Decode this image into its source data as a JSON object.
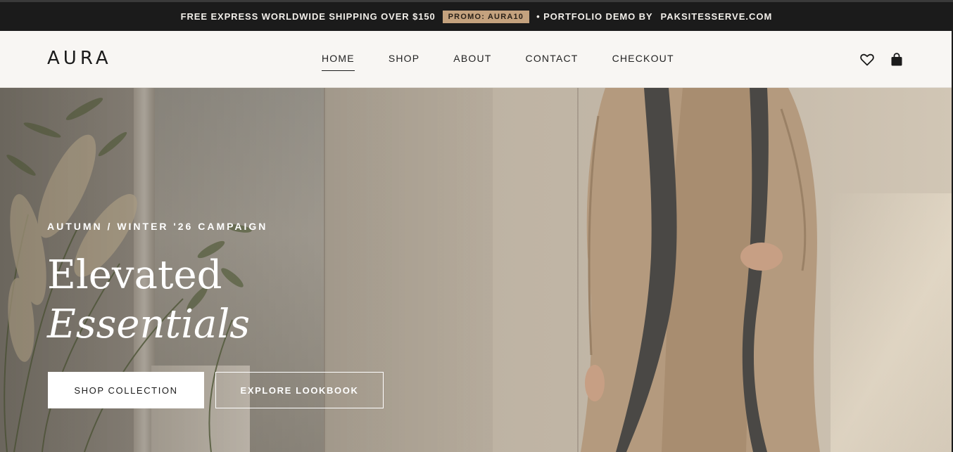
{
  "announcement": {
    "shipping_text": "FREE EXPRESS WORLDWIDE SHIPPING OVER $150",
    "promo_label": "PROMO: AURA10",
    "demo_prefix": "• PORTFOLIO DEMO BY",
    "demo_brand": "PAKSITESSERVE.COM"
  },
  "header": {
    "logo": "AURA",
    "nav": [
      {
        "label": "HOME",
        "active": true
      },
      {
        "label": "SHOP"
      },
      {
        "label": "ABOUT"
      },
      {
        "label": "CONTACT"
      },
      {
        "label": "CHECKOUT"
      }
    ],
    "icons": [
      "heart-icon",
      "shopping-bag-icon"
    ]
  },
  "hero": {
    "eyebrow": "AUTUMN / WINTER '26 CAMPAIGN",
    "headline_line1": "Elevated",
    "headline_line2": "Essentials",
    "primary_button": "SHOP COLLECTION",
    "secondary_button": "EXPLORE LOOKBOOK"
  },
  "colors": {
    "announcement_bg": "#1b1b1b",
    "promo_bg": "#c4a27e",
    "header_bg": "#f8f6f3",
    "text_dark": "#1b1b1b",
    "coat": "#b49a7e"
  }
}
